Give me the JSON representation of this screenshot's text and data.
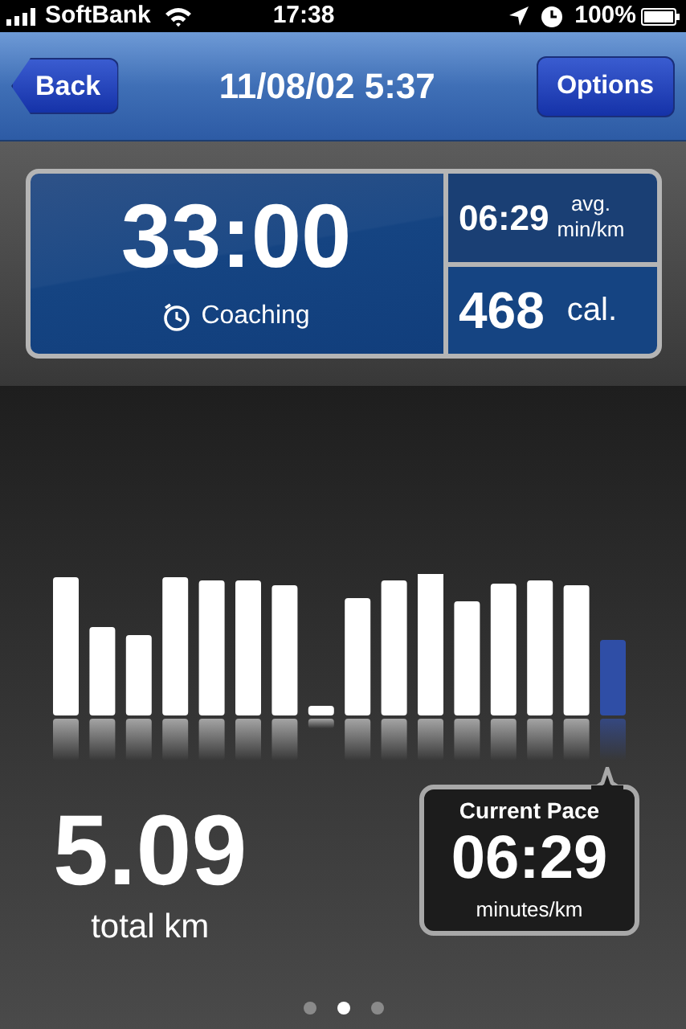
{
  "status_bar": {
    "carrier": "SoftBank",
    "time": "17:38",
    "battery": "100%"
  },
  "nav_bar": {
    "back": "Back",
    "title": "11/08/02 5:37",
    "options": "Options"
  },
  "summary": {
    "duration": "33:00",
    "mode": "Coaching",
    "avg_pace": "06:29",
    "avg_pace_unit_1": "avg.",
    "avg_pace_unit_2": "min/km",
    "calories": "468",
    "calories_unit": "cal."
  },
  "distance": {
    "value": "5.09",
    "unit": "total km"
  },
  "current_pace": {
    "label": "Current Pace",
    "value": "06:29",
    "unit": "minutes/km"
  },
  "pages": [
    {
      "selected": false
    },
    {
      "selected": true
    },
    {
      "selected": false
    }
  ]
}
